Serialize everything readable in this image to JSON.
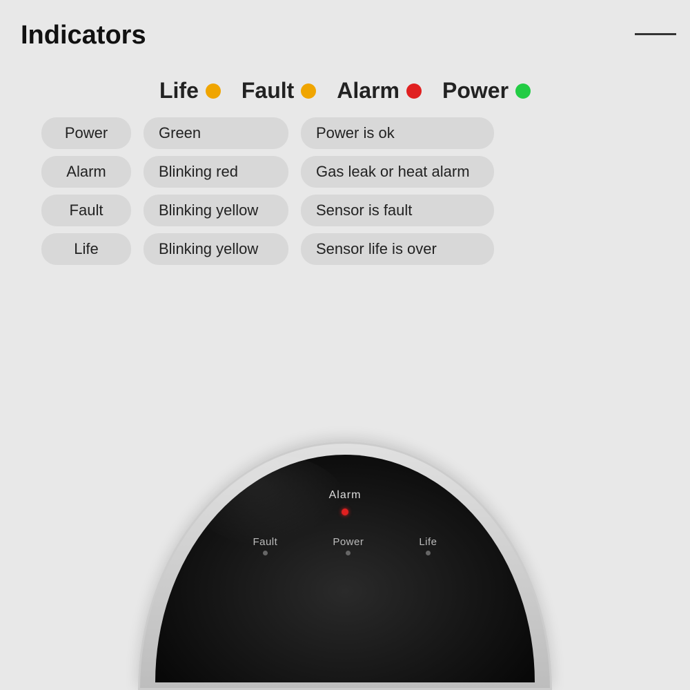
{
  "header": {
    "title": "Indicators",
    "line": true
  },
  "legend": {
    "items": [
      {
        "label": "Life",
        "dot_color": "yellow",
        "dot_class": "dot-yellow"
      },
      {
        "label": "Fault",
        "dot_color": "yellow",
        "dot_class": "dot-yellow"
      },
      {
        "label": "Alarm",
        "dot_color": "red",
        "dot_class": "dot-red"
      },
      {
        "label": "Power",
        "dot_color": "green",
        "dot_class": "dot-green"
      }
    ]
  },
  "table": {
    "rows": [
      {
        "indicator": "Power",
        "color": "Green",
        "description": "Power is ok"
      },
      {
        "indicator": "Alarm",
        "color": "Blinking red",
        "description": "Gas leak or heat alarm"
      },
      {
        "indicator": "Fault",
        "color": "Blinking yellow",
        "description": "Sensor is fault"
      },
      {
        "indicator": "Life",
        "color": "Blinking yellow",
        "description": "Sensor life is over"
      }
    ]
  },
  "device": {
    "alarm_label": "Alarm",
    "indicators": [
      {
        "label": "Fault"
      },
      {
        "label": "Power"
      },
      {
        "label": "Life"
      }
    ]
  }
}
